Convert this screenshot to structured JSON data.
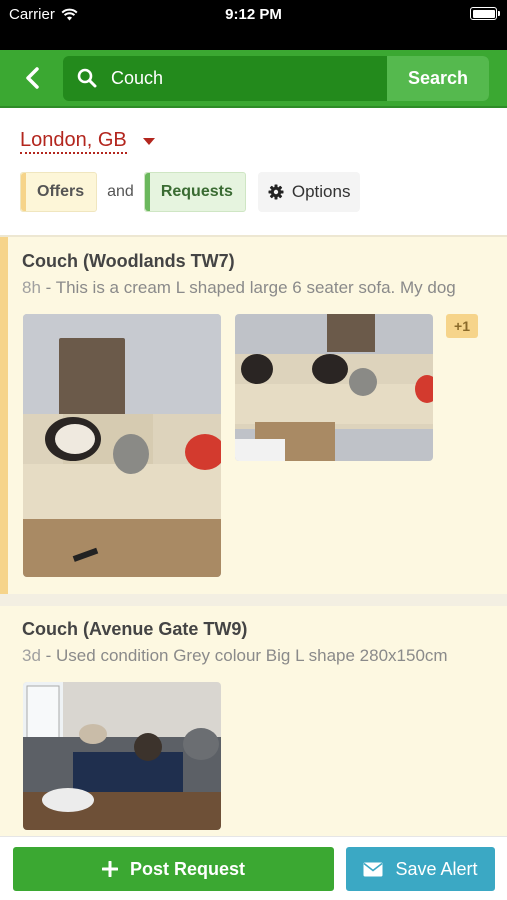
{
  "status_bar": {
    "carrier": "Carrier",
    "time": "9:12 PM"
  },
  "header": {
    "search_value": "Couch",
    "search_label": "Search"
  },
  "location": {
    "label": "London, GB"
  },
  "filters": {
    "offers_label": "Offers",
    "and_text": "and",
    "requests_label": "Requests",
    "options_label": "Options"
  },
  "listings": [
    {
      "title": "Couch (Woodlands TW7)",
      "age": "8h",
      "description": " - This is a cream L shaped large 6 seater sofa. My dog",
      "more_photos": "+1"
    },
    {
      "title": "Couch (Avenue Gate TW9)",
      "age": "3d",
      "description": " - Used condition Grey colour Big L shape 280x150cm"
    }
  ],
  "bottom_bar": {
    "post_label": "Post Request",
    "alert_label": "Save Alert"
  },
  "colors": {
    "brand_green": "#3ba832",
    "offer_yellow": "#f6d48a",
    "location_red": "#b3261e",
    "alert_blue": "#3ba8c4"
  }
}
